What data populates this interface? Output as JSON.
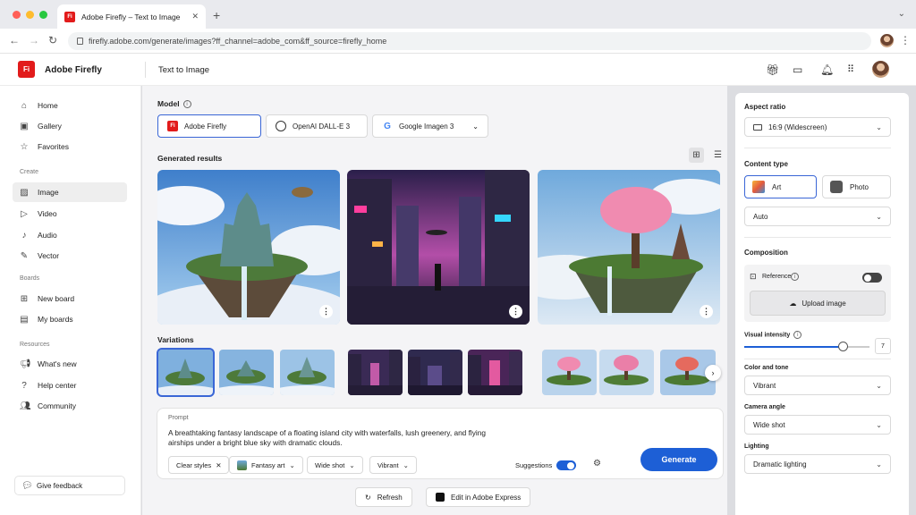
{
  "browser": {
    "tab_title": "Adobe Firefly – Text to Image",
    "tab_favicon": "Fi",
    "url": "firefly.adobe.com/generate/images?ff_channel=adobe_com&ff_source=firefly_home"
  },
  "header": {
    "logo": "Fi",
    "brand": "Adobe Firefly",
    "page_title": "Text to Image",
    "icons": [
      "gift-icon",
      "chat-icon",
      "bell-icon",
      "apps-grid-icon",
      "user-avatar"
    ]
  },
  "sidebar": {
    "items_top": [
      "Home",
      "Gallery",
      "Favorites"
    ],
    "section_create": "Create",
    "items_create": [
      "Image",
      "Video",
      "Audio",
      "Vector"
    ],
    "section_boards": "Boards",
    "items_boards": [
      "New board",
      "My boards"
    ],
    "section_resources": "Resources",
    "items_resources": [
      "What's new",
      "Help center",
      "Community"
    ],
    "feedback": "Give feedback",
    "active": "Image"
  },
  "main": {
    "model_label": "Model",
    "models": [
      "Adobe Firefly",
      "OpenAI DALL-E 3",
      "Google Imagen 3"
    ],
    "selected_model": "Adobe Firefly",
    "results_label": "Generated results",
    "variations_label": "Variations",
    "prompt_label": "Prompt",
    "prompt_text": "A breathtaking fantasy landscape of a floating island city with waterfalls, lush greenery, and flying airships under a bright blue sky with dramatic clouds.",
    "chips": [
      "Clear styles",
      "Fantasy art",
      "Wide shot",
      "Vibrant"
    ],
    "suggestions_label": "Suggestions",
    "suggestions_on": true,
    "generate": "Generate",
    "refresh": "Refresh",
    "edit_express": "Edit in Adobe Express"
  },
  "panel": {
    "aspect_label": "Aspect ratio",
    "aspect_value": "16:9 (Widescreen)",
    "content_label": "Content type",
    "content_art": "Art",
    "content_photo": "Photo",
    "content_mode": "Auto",
    "composition_label": "Composition",
    "reference_label": "Reference",
    "upload_label": "Upload image",
    "intensity_label": "Visual intensity",
    "intensity_value": "7",
    "color_label": "Color and tone",
    "color_value": "Vibrant",
    "camera_label": "Camera angle",
    "camera_value": "Wide shot",
    "lighting_label": "Lighting",
    "lighting_value": "Dramatic lighting"
  },
  "colors": {
    "accent": "#1d5fd6",
    "brand_red": "#e21b1b"
  }
}
